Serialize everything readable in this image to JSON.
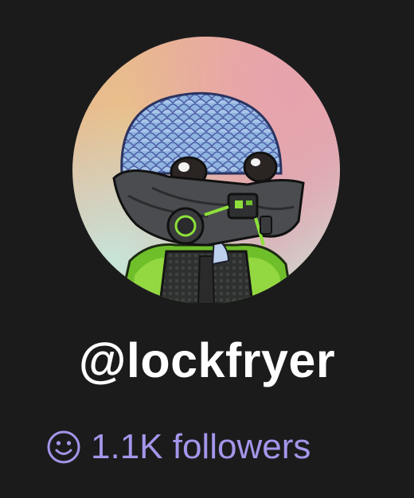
{
  "profile": {
    "username": "@lockfryer",
    "followers_label": "1.1K followers",
    "avatar_icon": "nft-avatar-masked-creature",
    "followers_icon": "smiley-face-icon"
  },
  "colors": {
    "background": "#1b1b1c",
    "username_text": "#ffffff",
    "followers_text": "#a595ea",
    "avatar_gradient": [
      "#e6b28c",
      "#e8a5a4",
      "#d9b0b8",
      "#cfe2d4"
    ]
  }
}
